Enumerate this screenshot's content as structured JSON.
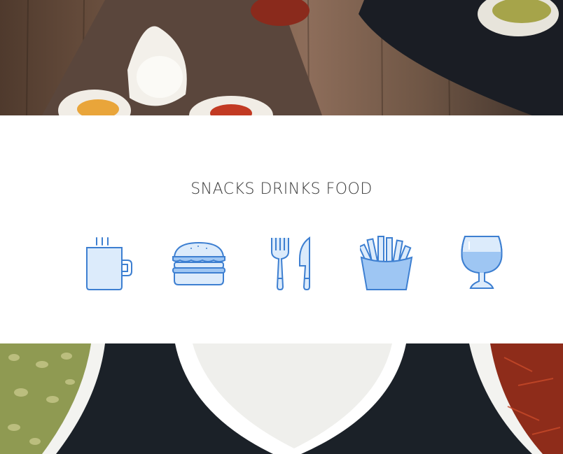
{
  "section": {
    "title": "SNACKS DRINKS FOOD"
  },
  "icons": [
    {
      "name": "coffee-mug-icon"
    },
    {
      "name": "burger-icon"
    },
    {
      "name": "fork-knife-icon"
    },
    {
      "name": "french-fries-icon"
    },
    {
      "name": "wine-glass-icon"
    }
  ],
  "colors": {
    "icon_stroke": "#3d7fd1",
    "icon_fill_light": "#dcebfb",
    "icon_fill_mid": "#9ec6f3",
    "title_text": "#3a3a3a"
  }
}
